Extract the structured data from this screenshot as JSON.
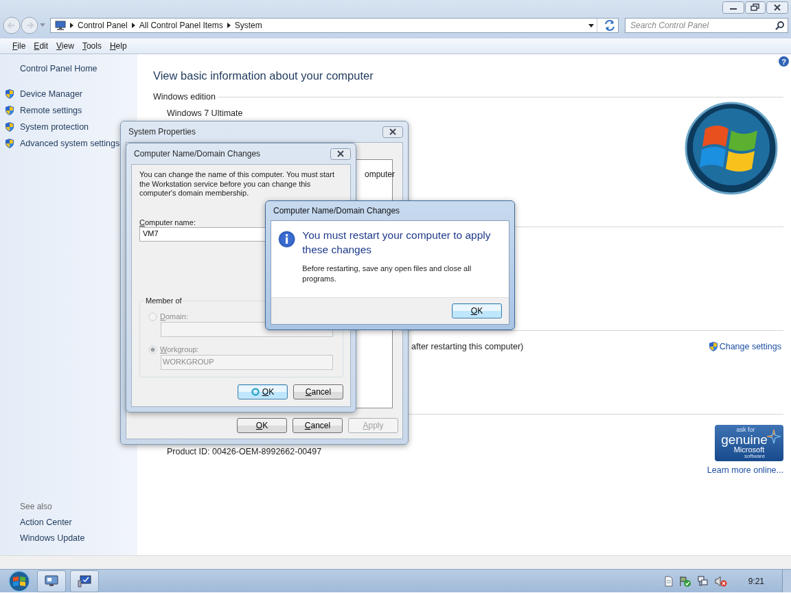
{
  "address_bar": {
    "breadcrumb": [
      "Control Panel",
      "All Control Panel Items",
      "System"
    ],
    "search": {
      "placeholder": "Search Control Panel"
    }
  },
  "menu": [
    "File",
    "Edit",
    "View",
    "Tools",
    "Help"
  ],
  "sidebar": {
    "home": "Control Panel Home",
    "tasks": [
      "Device Manager",
      "Remote settings",
      "System protection",
      "Advanced system settings"
    ],
    "see_also": {
      "heading": "See also",
      "links": [
        "Action Center",
        "Windows Update"
      ]
    }
  },
  "main": {
    "help": "?",
    "title": "View basic information about your computer",
    "edition_heading": "Windows edition",
    "edition": "Windows 7 Ultimate",
    "partial_line": "after restarting this computer)",
    "change_settings": "Change settings",
    "product_id": "Product ID: 00426-OEM-8992662-00497",
    "genuine_badge": [
      "ask for",
      "genuine",
      "Microsoft",
      "software"
    ],
    "learn_more": "Learn more online..."
  },
  "system_properties": {
    "title": "System Properties",
    "partial_text": "omputer",
    "buttons": [
      {
        "label": "OK",
        "disabled": false
      },
      {
        "label": "Cancel",
        "disabled": false
      },
      {
        "label": "Apply",
        "disabled": true
      }
    ]
  },
  "name_dialog": {
    "title": "Computer Name/Domain Changes",
    "description": "You can change the name of this computer. You must start the Workstation service before you can change this computer's domain membership.",
    "computer_name": {
      "label": "Computer name:",
      "value": "VM7"
    },
    "member_of": {
      "label": "Member of",
      "options": [
        {
          "label": "Domain:",
          "selected": false,
          "disabled": true
        },
        {
          "label": "Workgroup:",
          "selected": true,
          "disabled": true,
          "value": "WORKGROUP"
        }
      ]
    },
    "buttons": [
      {
        "label": "OK",
        "focused": true
      },
      {
        "label": "Cancel",
        "focused": false
      }
    ]
  },
  "message_box": {
    "title": "Computer Name/Domain Changes",
    "instruction": "You must restart your computer to apply these changes",
    "text": "Before restarting, save any open files and close all programs.",
    "buttons": [
      {
        "label": "OK",
        "focused": true
      }
    ]
  },
  "taskbar": {
    "clock": "9:21"
  }
}
